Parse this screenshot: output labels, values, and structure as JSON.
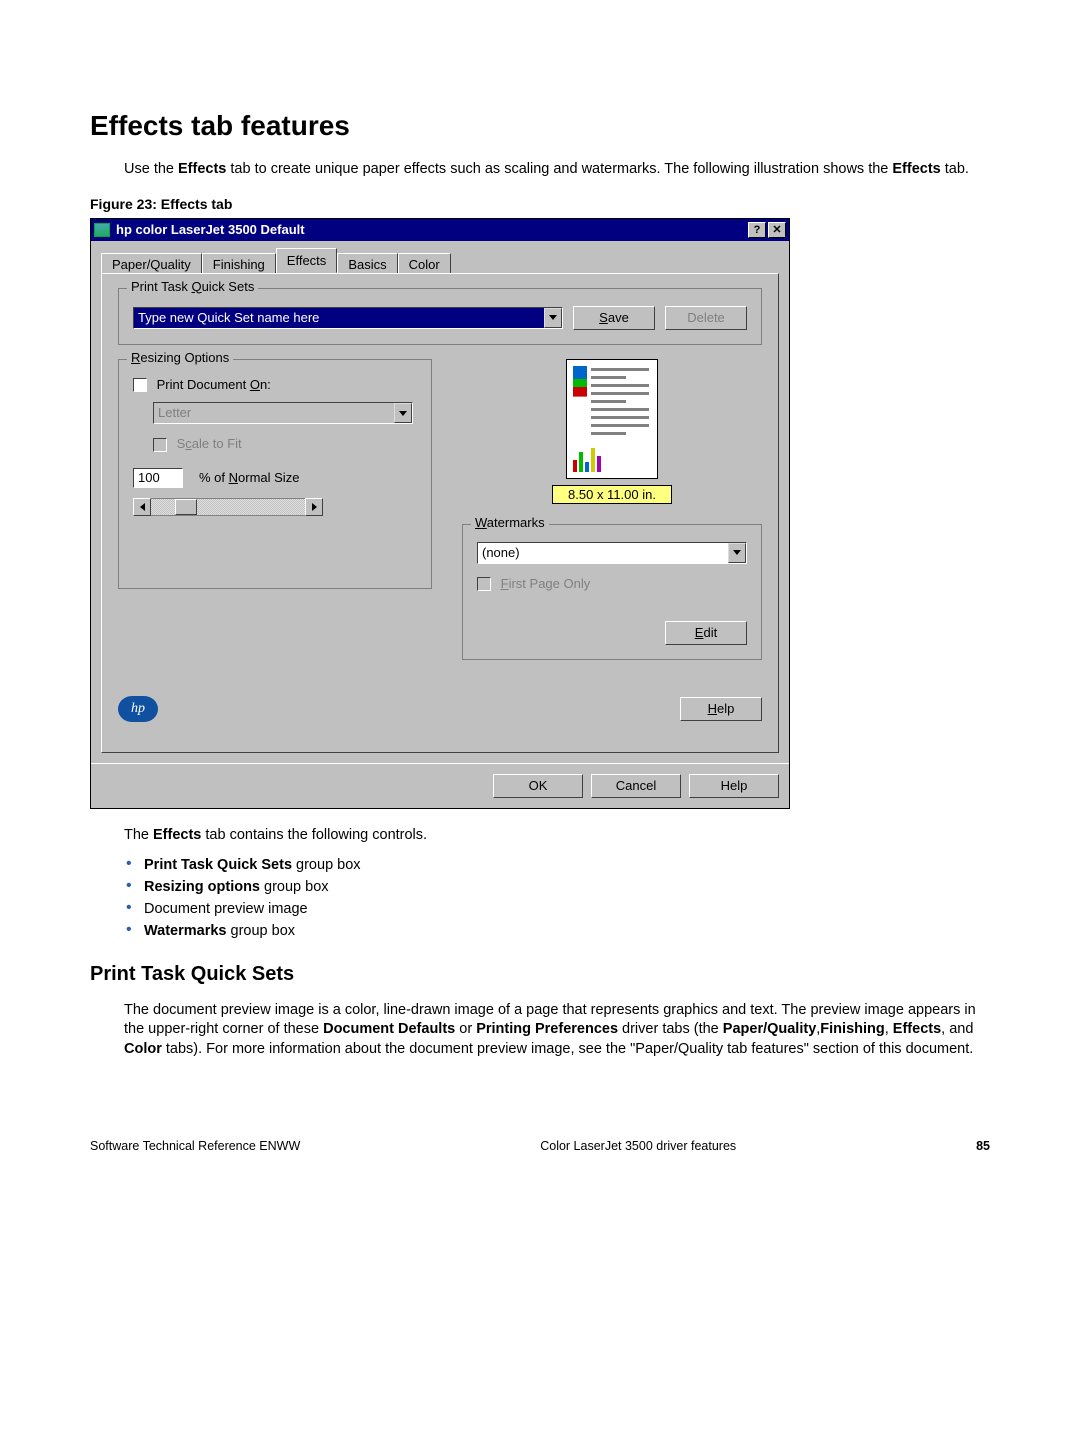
{
  "heading": "Effects tab features",
  "intro_parts": {
    "a": "Use the ",
    "b": "Effects",
    "c": " tab to create unique paper effects such as scaling and watermarks. The following illustration shows the ",
    "d": "Effects",
    "e": " tab."
  },
  "figure_caption": "Figure 23: Effects tab",
  "dialog": {
    "title": "hp color LaserJet 3500 Default",
    "help_glyph": "?",
    "close_glyph": "✕",
    "tabs": [
      "Paper/Quality",
      "Finishing",
      "Effects",
      "Basics",
      "Color"
    ],
    "active_tab_index": 2,
    "quicksets": {
      "legend": "Print Task Quick Sets",
      "combo_text": "Type new Quick Set name here",
      "save": "Save",
      "delete": "Delete"
    },
    "resizing": {
      "legend": "Resizing Options",
      "print_doc_on": "Print Document On:",
      "paper_size": "Letter",
      "scale_to_fit": "Scale to Fit",
      "percent_value": "100",
      "percent_label": "% of Normal Size"
    },
    "preview_label": "8.50 x 11.00 in.",
    "watermarks": {
      "legend": "Watermarks",
      "selected": "(none)",
      "first_page_only": "First Page Only",
      "edit": "Edit"
    },
    "help_btn": "Help",
    "bottom": {
      "ok": "OK",
      "cancel": "Cancel",
      "help": "Help"
    }
  },
  "after_intro": {
    "a": "The ",
    "b": "Effects",
    "c": " tab contains the following controls."
  },
  "bullets": [
    {
      "bold": "Print Task Quick Sets",
      "rest": " group box"
    },
    {
      "bold": "Resizing options",
      "rest": " group box"
    },
    {
      "bold": "",
      "rest": "Document preview image"
    },
    {
      "bold": "Watermarks",
      "rest": " group box"
    }
  ],
  "section_heading": "Print Task Quick Sets",
  "section_para": {
    "a": "The document preview image is a color, line-drawn image of a page that represents graphics and text. The preview image appears in the upper-right corner of these ",
    "b": "Document Defaults",
    "c": " or ",
    "d": "Printing Preferences",
    "e": " driver tabs (the ",
    "f": "Paper/Quality",
    "g": ",",
    "h": "Finishing",
    "i": ", ",
    "j": "Effects",
    "k": ", and ",
    "l": "Color",
    "m": " tabs). For more information about the document preview image, see the \"Paper/Quality tab features\" section of this document."
  },
  "footer": {
    "left": "Software Technical Reference ENWW",
    "center": "Color LaserJet 3500 driver features",
    "right": "85"
  }
}
